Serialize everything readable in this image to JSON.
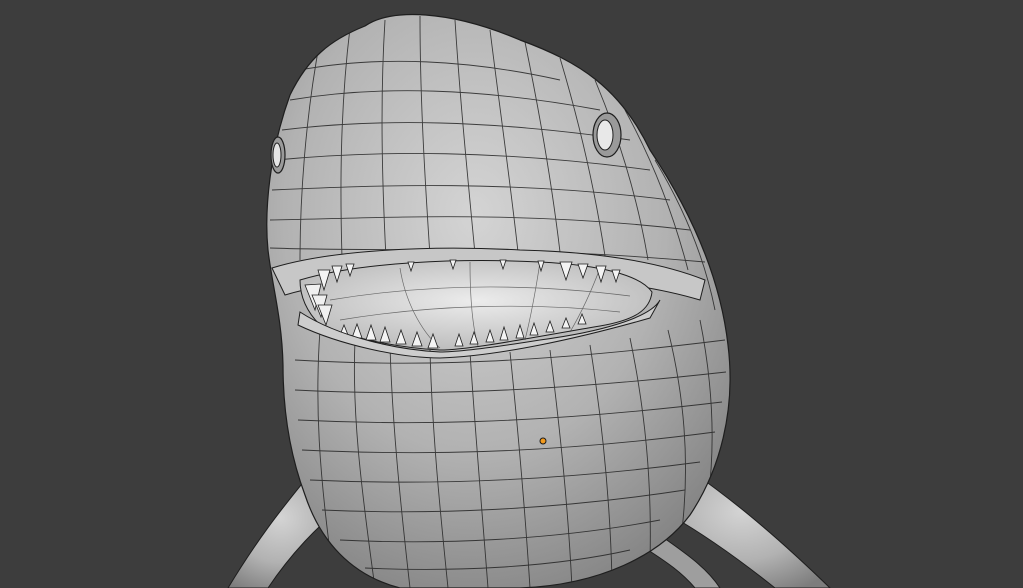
{
  "viewport": {
    "background_color": "#3d3d3d",
    "mode": "edit-mode-wireframe-overlay",
    "object": {
      "kind": "shark-model-mesh",
      "surface_color": "#b7b7b7",
      "wire_color": "#1e1e1e",
      "mouth_color": "#d8d8d8"
    },
    "origin_marker_color": "#f29a1d"
  }
}
